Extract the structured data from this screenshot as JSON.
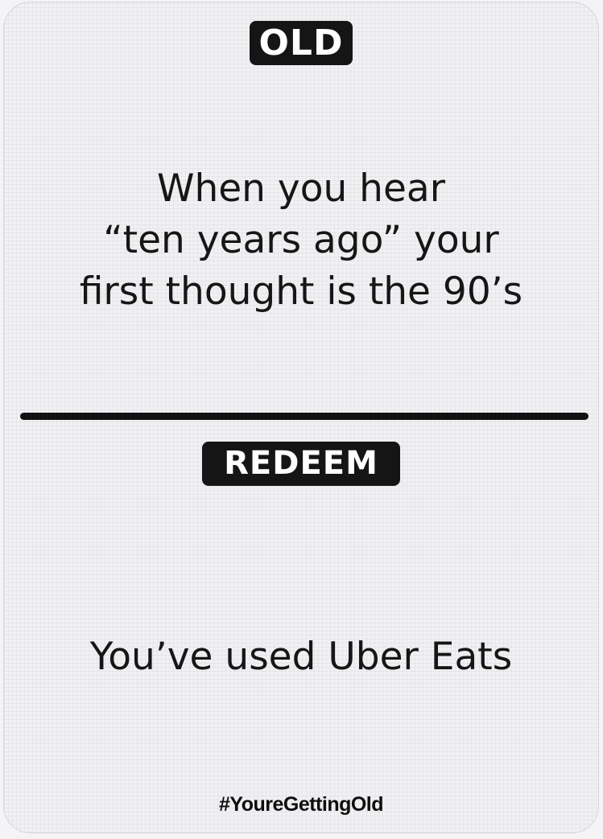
{
  "card": {
    "old_badge": "OLD",
    "old_lines": [
      "When you hear",
      "“ten years ago” your",
      "first thought is the 90’s"
    ],
    "redeem_badge": "REDEEM",
    "redeem_text": "You’ve used Uber Eats",
    "hashtag": "#YoureGettingOld"
  },
  "colors": {
    "card_background": "#f1f1f4",
    "ink": "#151515",
    "badge_text": "#ffffff"
  }
}
